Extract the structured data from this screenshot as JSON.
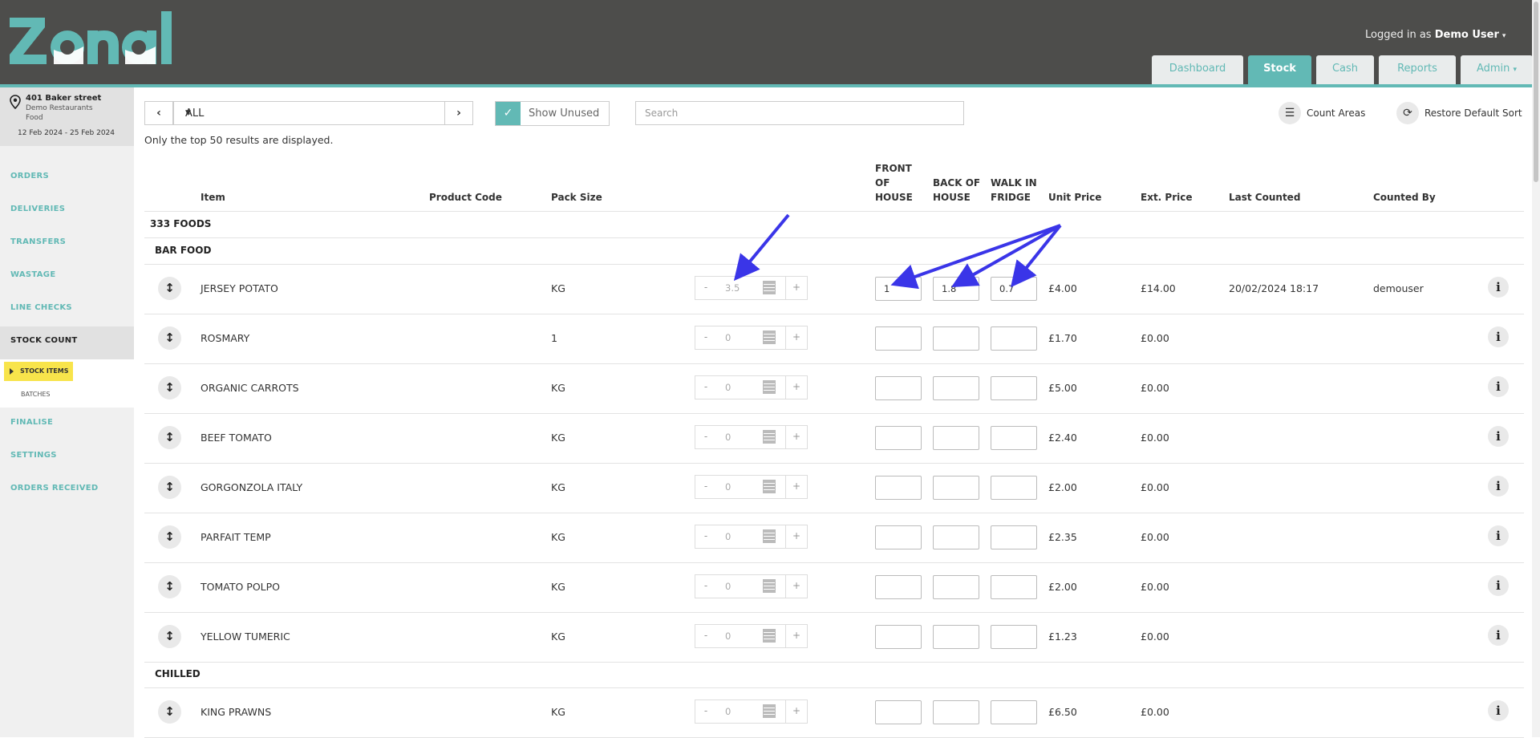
{
  "brand": {
    "logo_text": "Zonal",
    "teal": "#62b9b5",
    "header_bg": "#4d4d4b",
    "highlight": "#f8e44b",
    "annotation_arrow": "#3a35e8"
  },
  "header": {
    "user_prefix": "Logged in as",
    "user_name": "Demo User",
    "tabs": [
      "Dashboard",
      "Stock",
      "Cash",
      "Reports",
      "Admin"
    ],
    "active_tab": "Stock"
  },
  "sidebar": {
    "location": {
      "name": "401 Baker street",
      "company": "Demo Restaurants",
      "type": "Food",
      "period": "12 Feb 2024 - 25 Feb 2024"
    },
    "items": [
      "ORDERS",
      "DELIVERIES",
      "TRANSFERS",
      "WASTAGE",
      "LINE CHECKS",
      "STOCK COUNT",
      "FINALISE",
      "SETTINGS",
      "ORDERS RECEIVED"
    ],
    "active_item": "STOCK COUNT",
    "sub_items": [
      "STOCK ITEMS",
      "BATCHES"
    ],
    "active_sub": "STOCK ITEMS"
  },
  "toolbar": {
    "filter_value": "ALL",
    "show_unused_label": "Show Unused",
    "show_unused_checked": true,
    "search_placeholder": "Search",
    "count_areas_label": "Count Areas",
    "restore_sort_label": "Restore Default Sort",
    "notice": "Only the top 50 results are displayed."
  },
  "table": {
    "columns": {
      "item": "Item",
      "product_code": "Product Code",
      "pack_size": "Pack Size",
      "front_of_house": [
        "FRONT",
        "OF",
        "HOUSE"
      ],
      "back_of_house": [
        "BACK OF",
        "HOUSE"
      ],
      "walk_in_fridge": [
        "WALK IN",
        "FRIDGE"
      ],
      "unit_price": "Unit Price",
      "ext_price": "Ext. Price",
      "last_counted": "Last Counted",
      "counted_by": "Counted By"
    },
    "supplier": "333 FOODS",
    "groups": [
      {
        "name": "BAR FOOD",
        "rows": [
          {
            "item": "JERSEY POTATO",
            "pack_size": "KG",
            "total": "3.5",
            "front": "1",
            "back": "1.8",
            "fridge": "0.7",
            "unit_price": "£4.00",
            "ext_price": "£14.00",
            "last_counted": "20/02/2024 18:17",
            "counted_by": "demouser"
          },
          {
            "item": "ROSMARY",
            "pack_size": "1",
            "total": "0",
            "front": "",
            "back": "",
            "fridge": "",
            "unit_price": "£1.70",
            "ext_price": "£0.00",
            "last_counted": "",
            "counted_by": ""
          },
          {
            "item": "ORGANIC CARROTS",
            "pack_size": "KG",
            "total": "0",
            "front": "",
            "back": "",
            "fridge": "",
            "unit_price": "£5.00",
            "ext_price": "£0.00",
            "last_counted": "",
            "counted_by": ""
          },
          {
            "item": "BEEF TOMATO",
            "pack_size": "KG",
            "total": "0",
            "front": "",
            "back": "",
            "fridge": "",
            "unit_price": "£2.40",
            "ext_price": "£0.00",
            "last_counted": "",
            "counted_by": ""
          },
          {
            "item": "GORGONZOLA ITALY",
            "pack_size": "KG",
            "total": "0",
            "front": "",
            "back": "",
            "fridge": "",
            "unit_price": "£2.00",
            "ext_price": "£0.00",
            "last_counted": "",
            "counted_by": ""
          },
          {
            "item": "PARFAIT TEMP",
            "pack_size": "KG",
            "total": "0",
            "front": "",
            "back": "",
            "fridge": "",
            "unit_price": "£2.35",
            "ext_price": "£0.00",
            "last_counted": "",
            "counted_by": ""
          },
          {
            "item": "TOMATO POLPO",
            "pack_size": "KG",
            "total": "0",
            "front": "",
            "back": "",
            "fridge": "",
            "unit_price": "£2.00",
            "ext_price": "£0.00",
            "last_counted": "",
            "counted_by": ""
          },
          {
            "item": "YELLOW TUMERIC",
            "pack_size": "KG",
            "total": "0",
            "front": "",
            "back": "",
            "fridge": "",
            "unit_price": "£1.23",
            "ext_price": "£0.00",
            "last_counted": "",
            "counted_by": ""
          }
        ]
      },
      {
        "name": "CHILLED",
        "rows": [
          {
            "item": "KING PRAWNS",
            "pack_size": "KG",
            "total": "0",
            "front": "",
            "back": "",
            "fridge": "",
            "unit_price": "£6.50",
            "ext_price": "£0.00",
            "last_counted": "",
            "counted_by": ""
          }
        ]
      }
    ],
    "stepper_minus": "-",
    "stepper_plus": "+"
  }
}
